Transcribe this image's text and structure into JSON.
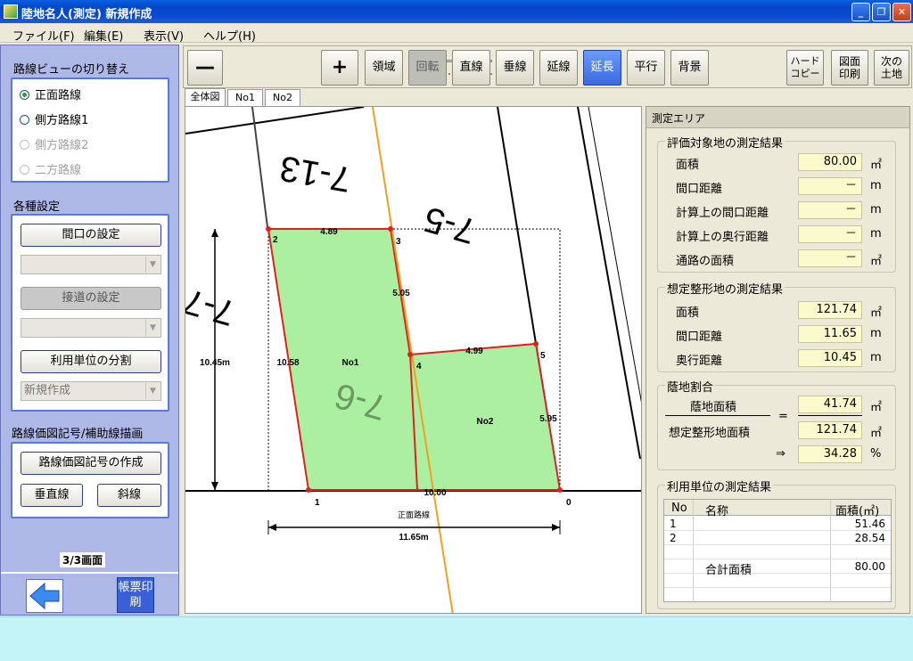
{
  "window": {
    "title": "陸地名人(測定) 新規作成"
  },
  "menu": [
    "ファイル(F)",
    "編集(E)",
    "表示(V)",
    "ヘルプ(H)"
  ],
  "left": {
    "route_view_title": "路線ビューの切り替え",
    "routes": [
      {
        "label": "正面路線",
        "selected": true,
        "enabled": true
      },
      {
        "label": "側方路線1",
        "selected": false,
        "enabled": true
      },
      {
        "label": "側方路線2",
        "selected": false,
        "enabled": false
      },
      {
        "label": "二方路線",
        "selected": false,
        "enabled": false
      }
    ],
    "settings_title": "各種設定",
    "frontage_button": "間口の設定",
    "access_button": "接道の設定",
    "split_button": "利用単位の分割",
    "new_combo": "新規作成",
    "draw_title": "路線価図記号/補助線描画",
    "create_symbol_button": "路線価図記号の作成",
    "vertical_button": "垂直線",
    "oblique_button": "斜線",
    "page_indicator": "3/3画面",
    "report_print_button": "帳票印刷"
  },
  "toolbar": {
    "zoom_out": "—",
    "zoom_in": "+",
    "zoom_level": 0.1,
    "buttons": [
      {
        "label": "領域",
        "state": "normal"
      },
      {
        "label": "回転",
        "state": "disabled"
      },
      {
        "label": "直線",
        "state": "normal"
      },
      {
        "label": "垂線",
        "state": "normal"
      },
      {
        "label": "延線",
        "state": "normal"
      },
      {
        "label": "延長",
        "state": "active"
      },
      {
        "label": "平行",
        "state": "normal"
      },
      {
        "label": "背景",
        "state": "normal"
      }
    ],
    "hardcopy": "ハード\nコピー",
    "plan_print": "図面\n印刷",
    "next_land": "次の\n土地"
  },
  "tabs": [
    "全体図",
    "No1",
    "No2"
  ],
  "drawing": {
    "lot_labels": [
      "7-13",
      "7-5",
      "7-6",
      "7-7"
    ],
    "vertex_labels": [
      "0",
      "1",
      "2",
      "3",
      "4",
      "5"
    ],
    "edge_labels": [
      "4.89",
      "5.05",
      "10.58",
      "4.99",
      "5.95",
      "10.00"
    ],
    "unit_labels": [
      "No1",
      "No2"
    ],
    "height_dim": "10.45m",
    "width_dim": "11.65m",
    "route_label": "正面路線",
    "colors": {
      "land_fill": "#aaf0a0",
      "boundary": "#e02020",
      "route": "#f0a020"
    }
  },
  "right": {
    "title": "測定エリア",
    "eval_title": "評価対象地の測定結果",
    "eval_rows": [
      {
        "label": "面積",
        "value": "80.00",
        "unit": "㎡"
      },
      {
        "label": "間口距離",
        "value": "－",
        "unit": "m"
      },
      {
        "label": "計算上の間口距離",
        "value": "－",
        "unit": "m"
      },
      {
        "label": "計算上の奥行距離",
        "value": "－",
        "unit": "m"
      },
      {
        "label": "通路の面積",
        "value": "－",
        "unit": "㎡"
      }
    ],
    "assumed_title": "想定整形地の測定結果",
    "assumed_rows": [
      {
        "label": "面積",
        "value": "121.74",
        "unit": "㎡"
      },
      {
        "label": "間口距離",
        "value": "11.65",
        "unit": "m"
      },
      {
        "label": "奥行距離",
        "value": "10.45",
        "unit": "m"
      }
    ],
    "ratio_title": "蔭地割合",
    "ratio": {
      "numerator_label": "蔭地面積",
      "numerator_value": "41.74",
      "numerator_unit": "㎡",
      "equals": "=",
      "denominator_label": "想定整形地面積",
      "denominator_value": "121.74",
      "denominator_unit": "㎡",
      "arrow": "⇒",
      "result_value": "34.28",
      "result_unit": "%"
    },
    "units_title": "利用単位の測定結果",
    "units_table": {
      "headers": [
        "No",
        "名称",
        "面積(㎡)"
      ],
      "rows": [
        [
          "1",
          "",
          "51.46"
        ],
        [
          "2",
          "",
          "28.54"
        ]
      ],
      "total_label": "合計面積",
      "total_value": "80.00"
    }
  }
}
